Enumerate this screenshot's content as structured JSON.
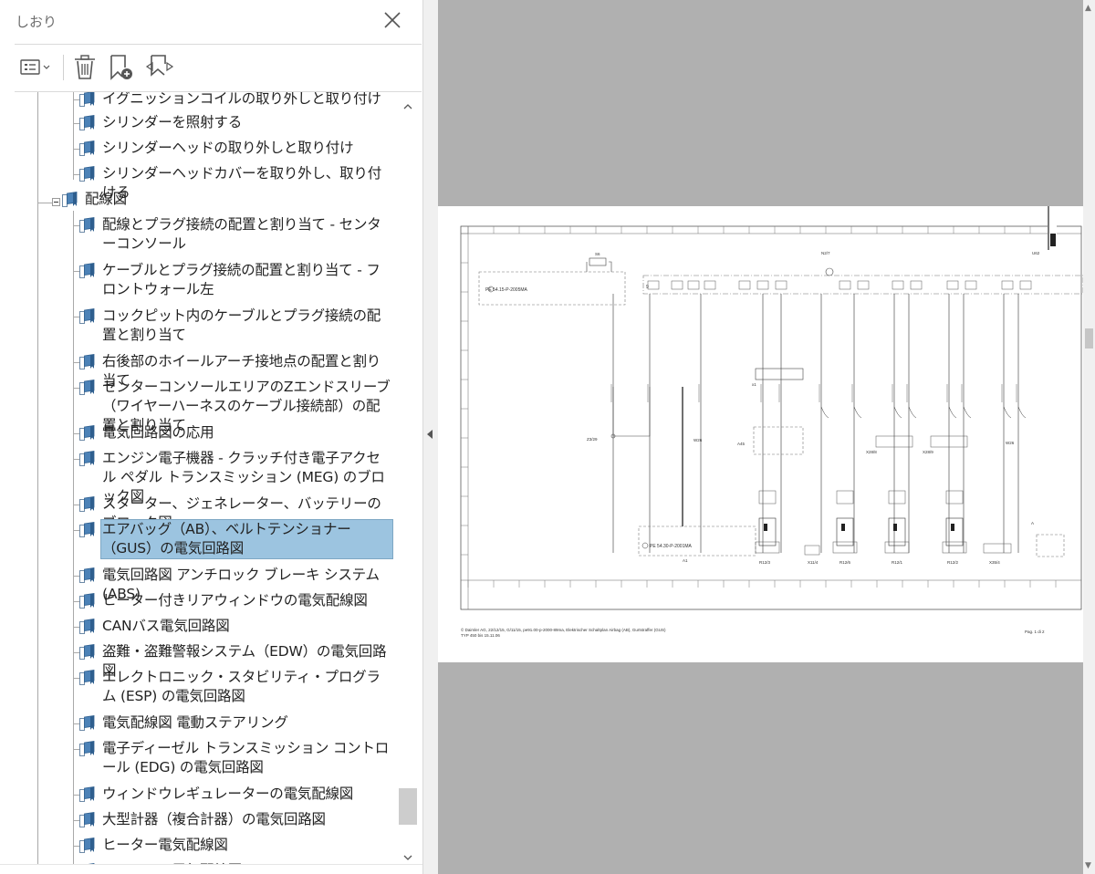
{
  "panel": {
    "title": "しおり",
    "toolbar": {
      "options_icon": "list-options-icon",
      "delete_icon": "trash-icon",
      "new_bookmark_icon": "new-bookmark-icon",
      "expand_icon": "expand-bookmark-icon"
    }
  },
  "bookmarks": {
    "items": [
      {
        "label": "イグニッションコイルの取り外しと取り付け",
        "level": 2
      },
      {
        "label": "シリンダーを照射する",
        "level": 2
      },
      {
        "label": "シリンダーヘッドの取り外しと取り付け",
        "level": 2
      },
      {
        "label": "シリンダーヘッドカバーを取り外し、取り付ける",
        "level": 2
      },
      {
        "label": "配線図",
        "level": 1,
        "expanded": true
      },
      {
        "label": "配線とプラグ接続の配置と割り当て - センターコンソール",
        "level": 2
      },
      {
        "label": "ケーブルとプラグ接続の配置と割り当て - フロントウォール左",
        "level": 2
      },
      {
        "label": "コックピット内のケーブルとプラグ接続の配置と割り当て",
        "level": 2
      },
      {
        "label": "右後部のホイールアーチ接地点の配置と割り当て",
        "level": 2
      },
      {
        "label": "センターコンソールエリアのZエンドスリーブ（ワイヤーハーネスのケーブル接続部）の配置と割り当て",
        "level": 2
      },
      {
        "label": "電気回路図の応用",
        "level": 2
      },
      {
        "label": "エンジン電子機器 - クラッチ付き電子アクセル ペダル トランスミッション (MEG) のブロック図",
        "level": 2
      },
      {
        "label": "スターター、ジェネレーター、バッテリーのブロック図",
        "level": 2
      },
      {
        "label": "エアバッグ（AB）、ベルトテンショナー（GUS）の電気回路図",
        "level": 2,
        "selected": true
      },
      {
        "label": "電気回路図 アンチロック ブレーキ システム (ABS)",
        "level": 2
      },
      {
        "label": "ヒーター付きリアウィンドウの電気配線図",
        "level": 2
      },
      {
        "label": "CANバス電気回路図",
        "level": 2
      },
      {
        "label": "盗難・盗難警報システム（EDW）の電気回路図",
        "level": 2
      },
      {
        "label": "エレクトロニック・スタビリティ・プログラム (ESP) の電気回路図",
        "level": 2
      },
      {
        "label": "電気配線図 電動ステアリング",
        "level": 2
      },
      {
        "label": "電子ディーゼル トランスミッション コントロール (EDG) の電気回路図",
        "level": 2
      },
      {
        "label": "ウィンドウレギュレーターの電気配線図",
        "level": 2
      },
      {
        "label": "大型計器（複合計器）の電気回路図",
        "level": 2
      },
      {
        "label": "ヒーター電気配線図",
        "level": 2
      },
      {
        "label": "エアコンの電気配線図",
        "level": 2
      }
    ]
  },
  "document": {
    "schematic": {
      "labels": {
        "s6": "S6",
        "n27": "N2/7",
        "u62": "U62",
        "pe_top": "PE 54.15-P-2005MA",
        "pe_bottom": "PE 54.30-P-2001MA",
        "z329": "Z3/29",
        "w26a": "W26",
        "a45": "A45",
        "x288": "X28/8",
        "x289": "X28/9",
        "w26b": "W26",
        "a1": "A1",
        "r123": "R12/3",
        "x114": "X11/4",
        "r126": "R12/6",
        "r121": "R12/1",
        "r122": "R12/2",
        "x354": "X35/4",
        "x1": "x1",
        "a_right": "A"
      },
      "footer_left": "© Daimler AG, 22/12/15, G/11/15, pe91.00-p-2000-89ma, Elektrischer Schaltplan Airbag (AB), Gurtstraffer (GUS)",
      "footer_left_2": "TYP 450 bis 15.11.06",
      "footer_right": "Pag. 1 di 2"
    }
  }
}
